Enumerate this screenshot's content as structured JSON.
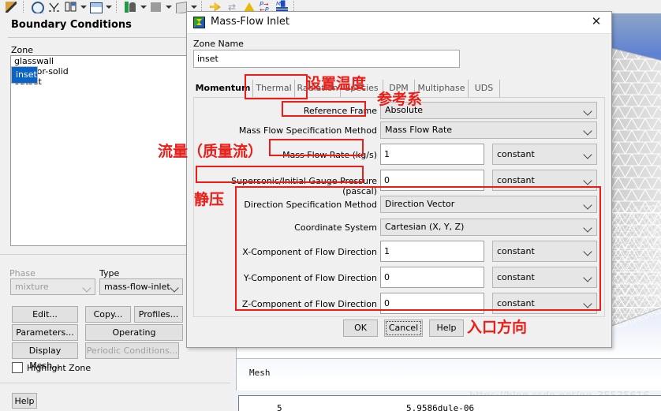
{
  "toolbar": {
    "icons": [
      "pipette-icon",
      "zoom-icon",
      "axes-icon",
      "layout-icon",
      "layout-dropdown-icon",
      "window-icon",
      "window-dropdown-icon",
      "lighting-icon",
      "lighting-dropdown-icon",
      "gray-swatch-icon",
      "swatch-dropdown-icon",
      "cube-icon",
      "cube-dropdown-icon",
      "reflect-icon",
      "rotate-icon",
      "contour-icon",
      "periodic-icon",
      "mode-icon"
    ]
  },
  "boundary_panel": {
    "title": "Boundary Conditions",
    "zone_label": "Zone",
    "zones": [
      "glasswall",
      "inset",
      "interior-solid",
      "outset"
    ],
    "selected_zone": "inset",
    "phase_label": "Phase",
    "phase_value": "mixture",
    "type_label": "Type",
    "type_value": "mass-flow-inlet",
    "buttons": {
      "edit": "Edit...",
      "copy": "Copy...",
      "profiles": "Profiles...",
      "parameters": "Parameters...",
      "operating_conditions": "Operating Conditions...",
      "display_mesh": "Display Mesh...",
      "periodic_conditions": "Periodic Conditions...",
      "help": "Help"
    },
    "highlight_zone_label": "Highlight Zone",
    "highlight_zone_checked": false
  },
  "dialog": {
    "title": "Mass-Flow Inlet",
    "icon": "fluent-app-icon",
    "close_label": "✕",
    "zone_name_label": "Zone Name",
    "zone_name_value": "inset",
    "tabs": [
      {
        "label": "Momentum",
        "active": true
      },
      {
        "label": "Thermal",
        "active": false
      },
      {
        "label": "Radiation",
        "active": false
      },
      {
        "label": "Species",
        "active": false
      },
      {
        "label": "DPM",
        "active": false
      },
      {
        "label": "Multiphase",
        "active": false
      },
      {
        "label": "UDS",
        "active": false
      }
    ],
    "fields": {
      "reference_frame_label": "Reference Frame",
      "reference_frame_value": "Absolute",
      "mass_flow_spec_label": "Mass Flow Specification Method",
      "mass_flow_spec_value": "Mass Flow Rate",
      "mass_flow_rate_label": "Mass Flow Rate (kg/s)",
      "mass_flow_rate_value": "1",
      "mass_flow_rate_mode": "constant",
      "supersonic_label": "Supersonic/Initial Gauge Pressure (pascal)",
      "supersonic_value": "0",
      "supersonic_mode": "constant",
      "direction_method_label": "Direction Specification Method",
      "direction_method_value": "Direction Vector",
      "coordinate_system_label": "Coordinate System",
      "coordinate_system_value": "Cartesian (X, Y, Z)",
      "x_component_label": "X-Component of Flow Direction",
      "x_component_value": "1",
      "x_component_mode": "constant",
      "y_component_label": "Y-Component of Flow Direction",
      "y_component_value": "0",
      "y_component_mode": "constant",
      "z_component_label": "Z-Component of Flow Direction",
      "z_component_value": "0",
      "z_component_mode": "constant"
    },
    "buttons": {
      "ok": "OK",
      "cancel": "Cancel",
      "help": "Help"
    }
  },
  "annotations": [
    {
      "id": "set-temperature",
      "text": "设置温度"
    },
    {
      "id": "reference-frame-note",
      "text": "参考系"
    },
    {
      "id": "mass-flow-note",
      "text": "流量（质量流）"
    },
    {
      "id": "static-pressure-note",
      "text": "静压"
    },
    {
      "id": "inlet-direction-note",
      "text": "入口方向"
    }
  ],
  "graphics": {
    "mesh_label": "Mesh",
    "watermark": "https://blog.csdn.net/qq_35535616",
    "console_col1": "5",
    "console_col2": "5.9586dule-06"
  },
  "colors": {
    "accent_red": "#ee1c16",
    "selection_blue": "#0a64c8",
    "sky_blue": "#5f81d2"
  }
}
